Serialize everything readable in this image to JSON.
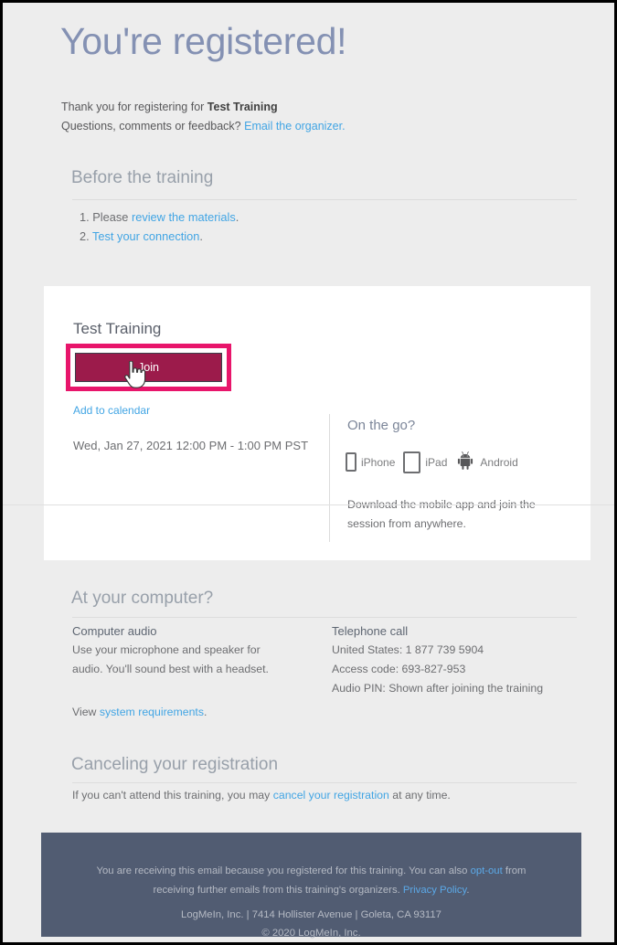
{
  "page": {
    "hero_title": "You're registered!",
    "background": "#ededed",
    "accent_link": "#42a5e4",
    "heading_color": "#98a0aa",
    "join_button_color": "#9c1b4b",
    "highlight_color": "#e8156b"
  },
  "intro": {
    "line1_prefix": "Thank you for registering for ",
    "line1_bold": "Test Training",
    "line2_prefix": "Questions, comments or feedback? ",
    "line2_link": "Email the organizer."
  },
  "before_training": {
    "heading": "Before the training",
    "items": [
      {
        "num": "1.",
        "prefix": "Please ",
        "link": "review the materials",
        "suffix": "."
      },
      {
        "num": "2.",
        "prefix": "",
        "link": "Test your connection",
        "suffix": "."
      }
    ]
  },
  "card": {
    "title": "Test Training",
    "join_label": "Join",
    "add_to_calendar": "Add to calendar",
    "when": "Wed, Jan 27, 2021 12:00 PM - 1:00 PM PST",
    "on_the_go": {
      "heading": "On the go?",
      "devices": [
        {
          "icon": "iphone-icon",
          "label": "iPhone"
        },
        {
          "icon": "ipad-icon",
          "label": "iPad"
        },
        {
          "icon": "android-icon",
          "label": "Android"
        }
      ],
      "note": "Download the mobile app and join the session from anywhere."
    }
  },
  "at_your_computer": {
    "heading": "At your computer?",
    "computer_audio": {
      "title": "Computer audio",
      "body": "Use your microphone and speaker for audio. You'll sound best with a headset."
    },
    "telephone_call": {
      "title": "Telephone call",
      "lines": [
        "United States: 1 877 739 5904",
        "Access code: 693-827-953",
        "Audio PIN: Shown after joining the training"
      ]
    },
    "view_requirements": {
      "prefix": "View ",
      "link": "system requirements",
      "suffix": "."
    }
  },
  "canceling": {
    "heading": "Canceling your registration",
    "prefix": "If you can't attend this training, you may ",
    "link": "cancel your registration",
    "suffix": " at any time."
  },
  "footer": {
    "line1_a": "You are receiving this email because you registered for this training. You can also ",
    "line1_link": "opt-out",
    "line1_b": " from",
    "line2_a": "receiving further emails from this training's organizers. ",
    "line2_link": "Privacy Policy",
    "line2_b": ".",
    "address": "LogMeIn, Inc. | 7414 Hollister Avenue | Goleta, CA 93117",
    "copyright": "© 2020 LogMeIn, Inc."
  }
}
